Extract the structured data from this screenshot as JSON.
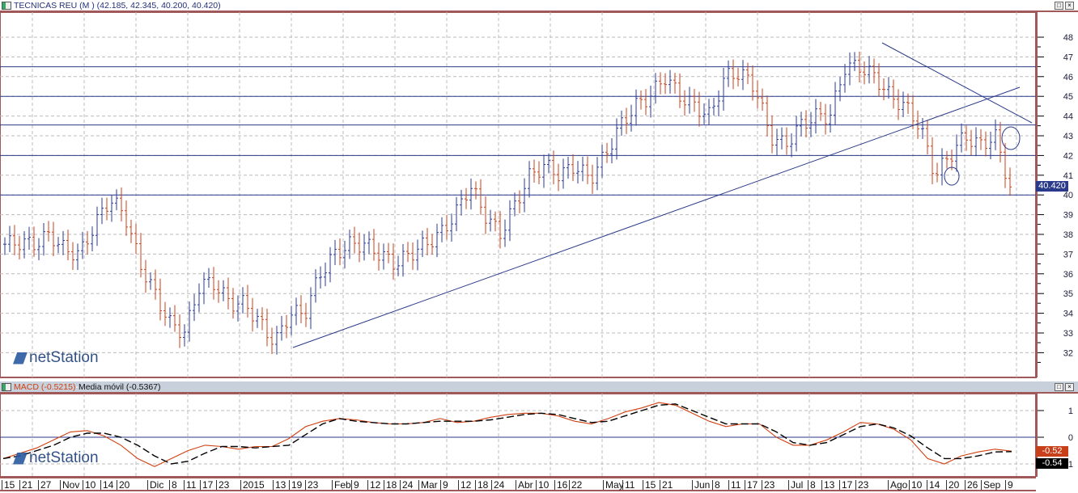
{
  "main_window": {
    "title": "TECNICAS REU (M ) (42.185, 42.345, 40.200, 40.420)",
    "last_price_label": "40.420",
    "price_ticks": [
      "48",
      "47",
      "46",
      "45",
      "44",
      "43",
      "42",
      "41",
      "40",
      "39",
      "38",
      "37",
      "36",
      "35",
      "34",
      "33",
      "32"
    ]
  },
  "macd_window": {
    "macd_label": "MACD (-0.5215)",
    "separator": " - ",
    "signal_label": "Media móvil (-0.5367)",
    "ticks": [
      "1",
      "0",
      "-1"
    ],
    "macd_value_box": "-0.52",
    "signal_value_box": "-0.54"
  },
  "logo": {
    "brand": "netStation"
  },
  "window_buttons": {
    "maximize": "□",
    "close": "×"
  },
  "colors": {
    "up": "#2a3a9a",
    "down": "#c8401a",
    "macd": "#d04010",
    "signal": "#000000",
    "lines": "#2a3a8a",
    "border": "#a05858"
  },
  "date_axis": [
    "15",
    "21",
    "27",
    "Nov",
    "10",
    "14",
    "20",
    "Dic",
    "8",
    "11",
    "17",
    "23",
    "2015",
    "13",
    "19",
    "23",
    "Feb",
    "9",
    "12",
    "18",
    "24",
    "Mar",
    "9",
    "12",
    "18",
    "24",
    "Abr",
    "10",
    "16",
    "22",
    "May",
    "11",
    "15",
    "21",
    "Jun",
    "8",
    "11",
    "17",
    "23",
    "Jul",
    "8",
    "13",
    "17",
    "23",
    "Ago",
    "10",
    "14",
    "20",
    "26",
    "Sep",
    "9"
  ],
  "price_series": [
    37.5,
    37.6,
    37.5,
    38,
    37.2,
    37,
    38.5,
    39.8,
    39,
    36.5,
    35,
    33.5,
    33,
    35.5,
    35.5,
    34.5,
    34.5,
    33.5,
    32.5,
    34,
    34,
    36,
    37,
    37.5,
    37.5,
    37,
    36.5,
    37,
    37.5,
    38,
    39,
    40.5,
    39,
    38,
    39.5,
    41,
    41.5,
    41,
    41.5,
    40.8,
    42,
    43.5,
    44.5,
    45,
    46,
    45,
    44.5,
    44,
    46,
    46.2,
    45.5,
    43,
    42.5,
    43.5,
    44,
    44,
    46.5,
    46.5,
    46,
    45,
    44.5,
    43.5,
    41,
    42,
    43,
    42.5,
    43,
    40.4
  ],
  "horizontal_levels": [
    46.5,
    45.0,
    43.55,
    42.0,
    40.0
  ],
  "chart_data": {
    "type": "line",
    "series": [
      {
        "name": "MACD",
        "values": [
          -0.8,
          -0.6,
          -0.4,
          -0.1,
          0.2,
          0.25,
          0.05,
          -0.3,
          -0.8,
          -1.1,
          -0.8,
          -0.5,
          -0.3,
          -0.35,
          -0.45,
          -0.35,
          -0.35,
          -0.05,
          0.4,
          0.6,
          0.7,
          0.65,
          0.55,
          0.5,
          0.5,
          0.55,
          0.7,
          0.55,
          0.6,
          0.75,
          0.85,
          0.9,
          0.9,
          0.8,
          0.6,
          0.5,
          0.7,
          0.95,
          1.1,
          1.3,
          1.2,
          0.9,
          0.6,
          0.4,
          0.5,
          0.5,
          0.0,
          -0.3,
          -0.3,
          -0.1,
          0.2,
          0.55,
          0.5,
          0.3,
          -0.1,
          -0.8,
          -1.0,
          -0.7,
          -0.55,
          -0.45,
          -0.52
        ]
      },
      {
        "name": "Media móvil",
        "values": [
          -0.8,
          -0.7,
          -0.5,
          -0.3,
          0.0,
          0.15,
          0.15,
          0.0,
          -0.3,
          -0.7,
          -1.0,
          -0.9,
          -0.6,
          -0.35,
          -0.35,
          -0.4,
          -0.35,
          -0.3,
          0.1,
          0.5,
          0.7,
          0.6,
          0.55,
          0.5,
          0.5,
          0.55,
          0.6,
          0.6,
          0.6,
          0.65,
          0.75,
          0.85,
          0.9,
          0.85,
          0.7,
          0.55,
          0.6,
          0.8,
          1.0,
          1.2,
          1.25,
          1.0,
          0.75,
          0.5,
          0.5,
          0.5,
          0.2,
          -0.2,
          -0.3,
          -0.2,
          0.1,
          0.4,
          0.5,
          0.35,
          0.05,
          -0.4,
          -0.8,
          -0.8,
          -0.7,
          -0.55,
          -0.54
        ]
      }
    ],
    "ylim": [
      -1.5,
      1.5
    ]
  }
}
